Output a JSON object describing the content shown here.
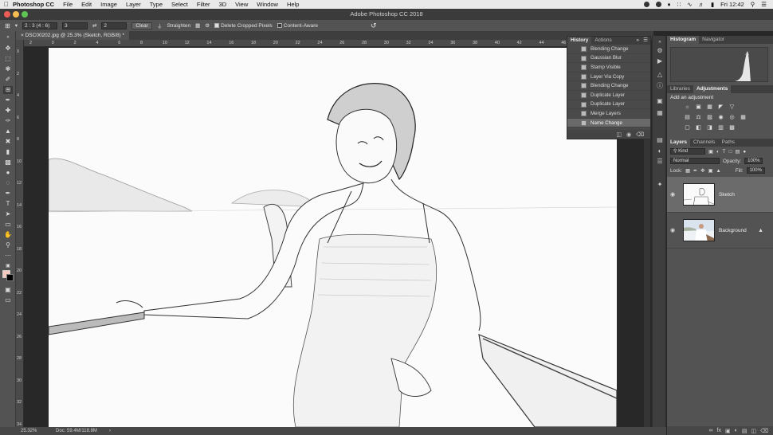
{
  "menubar": {
    "app_name": "Photoshop CC",
    "items": [
      "File",
      "Edit",
      "Image",
      "Layer",
      "Type",
      "Select",
      "Filter",
      "3D",
      "View",
      "Window",
      "Help"
    ],
    "clock": "Fri 12:42"
  },
  "window": {
    "title": "Adobe Photoshop CC 2018"
  },
  "options_bar": {
    "ratio_value": "2 : 3 (4 : 6)",
    "width_value": "3",
    "height_value": "2",
    "clear_label": "Clear",
    "straighten_label": "Straighten",
    "delete_cropped_label": "Delete Cropped Pixels",
    "content_aware_label": "Content-Aware"
  },
  "document": {
    "tab_label": "DSC00202.jpg @ 25.3% (Sketch, RGB/8) *"
  },
  "rulers": {
    "horizontal": [
      "2",
      "0",
      "2",
      "4",
      "6",
      "8",
      "10",
      "12",
      "14",
      "16",
      "18",
      "20",
      "22",
      "24",
      "26",
      "28",
      "30",
      "32",
      "34",
      "36",
      "38",
      "40",
      "42",
      "44",
      "46",
      "48",
      "50",
      "52"
    ],
    "vertical": [
      "0",
      "2",
      "4",
      "6",
      "8",
      "10",
      "12",
      "14",
      "16",
      "18",
      "20",
      "22",
      "24",
      "26",
      "28",
      "30",
      "32",
      "34"
    ]
  },
  "status": {
    "zoom": "25.32%",
    "doc": "Doc: 59.4M/118.8M"
  },
  "history_panel": {
    "tabs": [
      "History",
      "Actions"
    ],
    "items": [
      "Blending Change",
      "Gaussian Blur",
      "Stamp Visible",
      "Layer Via Copy",
      "Blending Change",
      "Duplicate Layer",
      "Duplicate Layer",
      "Merge Layers",
      "Name Change"
    ],
    "selected_index": 8
  },
  "histogram_panel": {
    "tabs": [
      "Histogram",
      "Navigator"
    ]
  },
  "adjustments_panel": {
    "tabs": [
      "Libraries",
      "Adjustments"
    ],
    "hint": "Add an adjustment"
  },
  "layers_panel": {
    "tabs": [
      "Layers",
      "Channels",
      "Paths"
    ],
    "filter": "Kind",
    "blend_mode": "Normal",
    "opacity_label": "Opacity:",
    "opacity_value": "100%",
    "lock_label": "Lock:",
    "fill_label": "Fill:",
    "fill_value": "100%",
    "layers": [
      {
        "name": "Sketch",
        "selected": true
      },
      {
        "name": "Background",
        "selected": false
      }
    ]
  },
  "colors": {
    "foreground": "#f2c9bd",
    "background": "#000000",
    "accent": "#6b6b6b"
  }
}
